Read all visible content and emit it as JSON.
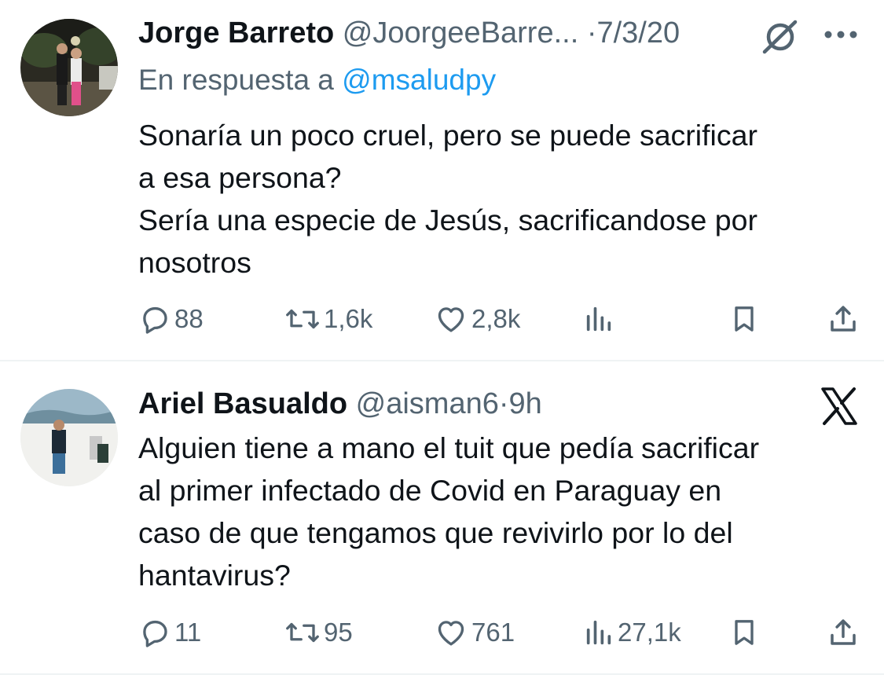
{
  "tweets": [
    {
      "author_name": "Jorge Barreto",
      "handle": "@JoorgeeBarre...",
      "separator": "·",
      "time": "7/3/20",
      "reply_prefix": "En respuesta a",
      "reply_to": "@msaludpy",
      "text_lines": [
        "Sonaría un poco cruel, pero se puede sacrificar",
        "a esa persona?",
        "Sería una especie de Jesús, sacrificandose por",
        "nosotros"
      ],
      "replies": "88",
      "retweets": "1,6k",
      "likes": "2,8k",
      "views": "",
      "top_icon": "grok-slash-icon",
      "more_icon": "more-dots-icon"
    },
    {
      "author_name": "Ariel Basualdo",
      "handle": "@aisman6",
      "separator": "·",
      "time": "9h",
      "text_lines": [
        "Alguien tiene a mano el tuit que pedía sacrificar",
        "al primer infectado de Covid en Paraguay en",
        "caso de que tengamos que revivirlo por lo del",
        "hantavirus?"
      ],
      "replies": "11",
      "retweets": "95",
      "likes": "761",
      "views": "27,1k",
      "top_icon": "x-logo-icon"
    }
  ],
  "colors": {
    "text": "#0f1419",
    "secondary": "#536471",
    "link": "#1d9bf0",
    "divider": "#eff3f4"
  },
  "icons": [
    "reply-icon",
    "retweet-icon",
    "like-icon",
    "views-icon",
    "bookmark-icon",
    "share-icon"
  ]
}
